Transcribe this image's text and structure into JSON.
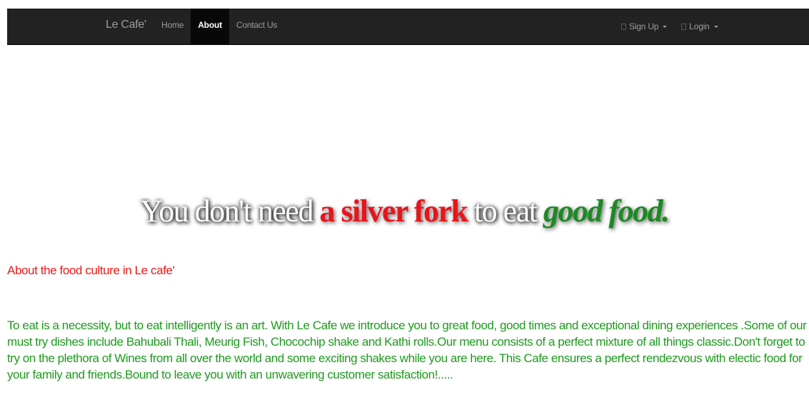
{
  "navbar": {
    "brand": "Le Cafe'",
    "items": [
      {
        "label": "Home",
        "active": false
      },
      {
        "label": "About",
        "active": true
      },
      {
        "label": "Contact Us",
        "active": false
      }
    ],
    "right_items": [
      {
        "label": "Sign Up",
        "icon": "user-icon"
      },
      {
        "label": "Login",
        "icon": "user-icon"
      }
    ]
  },
  "hero": {
    "part1": "You don't need ",
    "part2": "a silver fork",
    "part3": " to eat ",
    "part4": "good food."
  },
  "about": {
    "heading": "About the food culture in Le cafe'",
    "body": "To eat is a necessity, but to eat intelligently is an art. With Le Cafe we introduce you to great food, good times and exceptional dining experiences .Some of our must try dishes include Bahubali Thali, Meurig Fish, Chocochip shake and Kathi rolls.Our menu consists of a perfect mixture of all things classic.Don't forget to try on the plethora of Wines from all over the world and some exciting shakes while you are here. This Cafe ensures a perfect rendezvous with electic food for your family and friends.Bound to leave you with an unwavering customer satisfaction!....."
  },
  "colors": {
    "navbar_bg": "#222222",
    "heading_red": "#e81a1a",
    "body_green": "#1e9a1e"
  }
}
